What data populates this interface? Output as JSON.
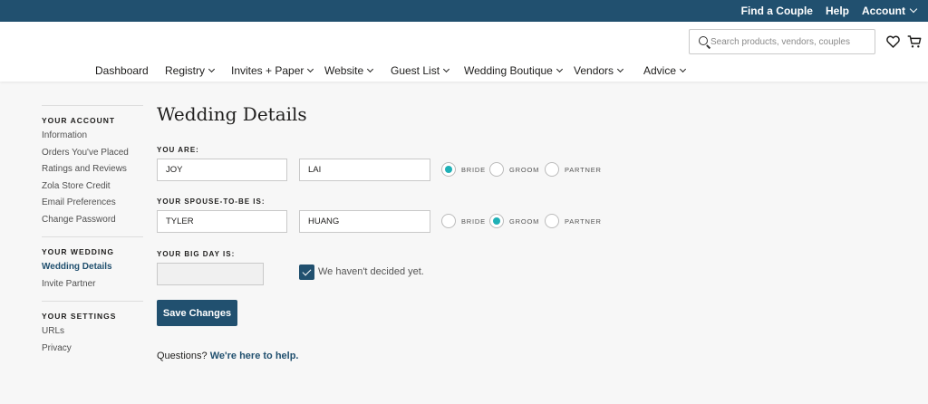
{
  "topbar": {
    "find_couple": "Find a Couple",
    "help": "Help",
    "account": "Account"
  },
  "header": {
    "search_placeholder": "Search products, vendors, couples",
    "nav": [
      {
        "label": "Dashboard"
      },
      {
        "label": "Registry"
      },
      {
        "label": "Invites + Paper"
      },
      {
        "label": "Website"
      },
      {
        "label": "Guest List"
      },
      {
        "label": "Wedding Boutique"
      },
      {
        "label": "Vendors"
      },
      {
        "label": "Advice"
      }
    ]
  },
  "sidebar": {
    "account_title": "YOUR ACCOUNT",
    "account_items": [
      "Information",
      "Orders You've Placed",
      "Ratings and Reviews",
      "Zola Store Credit",
      "Email Preferences",
      "Change Password"
    ],
    "wedding_title": "YOUR WEDDING",
    "wedding_items": [
      "Wedding Details",
      "Invite Partner"
    ],
    "settings_title": "YOUR SETTINGS",
    "settings_items": [
      "URLs",
      "Privacy"
    ]
  },
  "main": {
    "title": "Wedding Details",
    "you_are_label": "YOU ARE:",
    "you_first": "JOY",
    "you_last": "LAI",
    "spouse_label": "YOUR SPOUSE-TO-BE IS:",
    "spouse_first": "TYLER",
    "spouse_last": "HUANG",
    "role_options": [
      "BRIDE",
      "GROOM",
      "PARTNER"
    ],
    "you_role": "BRIDE",
    "spouse_role": "GROOM",
    "big_day_label": "YOUR BIG DAY IS:",
    "big_day_value": "",
    "undecided_label": "We haven't decided yet.",
    "undecided_checked": true,
    "save_label": "Save Changes",
    "questions_text": "Questions?",
    "help_link": "We're here to help."
  },
  "colors": {
    "brand_navy": "#21506f",
    "radio_teal": "#1fb0b6",
    "page_bg": "#f7f7f7"
  }
}
